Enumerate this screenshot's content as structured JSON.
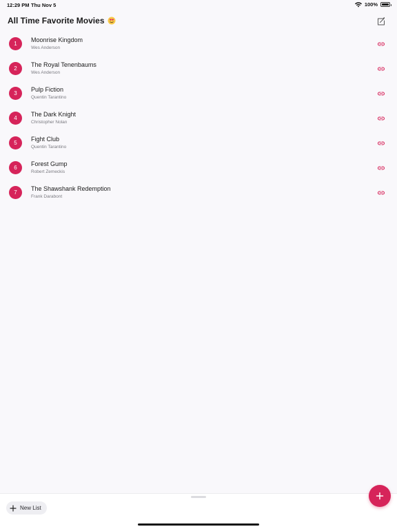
{
  "status_bar": {
    "time": "12:29 PM",
    "date": "Thu Nov 5",
    "battery": "100%",
    "battery_level": 1.0
  },
  "header": {
    "title": "All Time Favorite Movies",
    "emoji": "smiling-face-with-heart-eyes",
    "edit_icon": "note-edit-icon"
  },
  "movies": [
    {
      "rank": "1",
      "title": "Moonrise Kingdom",
      "director": "Wes Anderson"
    },
    {
      "rank": "2",
      "title": "The Royal Tenenbaums",
      "director": "Wes Anderson"
    },
    {
      "rank": "3",
      "title": "Pulp Fiction",
      "director": "Quentin Tarantino"
    },
    {
      "rank": "4",
      "title": "The Dark Knight",
      "director": "Christopher Nolan"
    },
    {
      "rank": "5",
      "title": "Fight Club",
      "director": "Quentin Tarantino"
    },
    {
      "rank": "6",
      "title": "Forest Gump",
      "director": "Robert Zemeckis"
    },
    {
      "rank": "7",
      "title": "The Shawshank Redemption",
      "director": "Frank Darabont"
    }
  ],
  "bottom": {
    "new_list_label": "New List"
  },
  "colors": {
    "accent": "#d6245a",
    "background": "#f9f8fb"
  }
}
